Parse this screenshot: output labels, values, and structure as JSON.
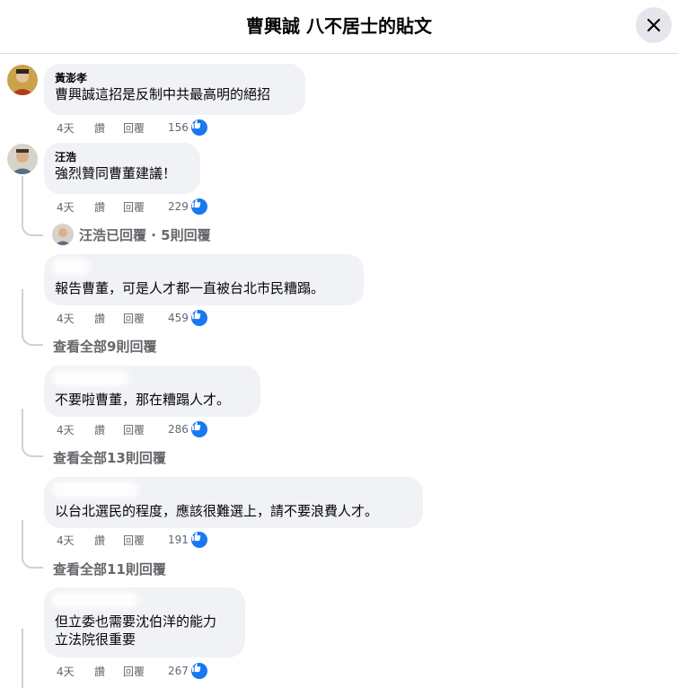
{
  "header": {
    "title": "曹興誠 八不居士的貼文",
    "close_icon": "close-icon"
  },
  "actions": {
    "like": "讚",
    "reply": "回覆"
  },
  "comments": [
    {
      "author": "黃澎孝",
      "text": "曹興誠這招是反制中共最高明的絕招",
      "time": "4天",
      "likes": "156"
    },
    {
      "author": "汪浩",
      "text": "強烈贊同曹董建議！",
      "time": "4天",
      "likes": "229",
      "replied_summary": "汪浩已回覆 · 5則回覆"
    }
  ],
  "replies": [
    {
      "text": "報告曹董，可是人才都一直被台北市民糟蹋。",
      "time": "4天",
      "likes": "459",
      "view_more": "查看全部9則回覆"
    },
    {
      "text": "不要啦曹董，那在糟蹋人才。",
      "time": "4天",
      "likes": "286",
      "view_more": "查看全部13則回覆"
    },
    {
      "text": "以台北選民的程度，應該很難選上，請不要浪費人才。",
      "time": "4天",
      "likes": "191",
      "view_more": "查看全部11則回覆"
    },
    {
      "text_line1": "但立委也需要沈伯洋的能力",
      "text_line2": "立法院很重要",
      "time": "4天",
      "likes": "267"
    }
  ],
  "colors": {
    "accent": "#1877f2",
    "bubble": "#f0f2f5",
    "muted": "#65676b"
  }
}
